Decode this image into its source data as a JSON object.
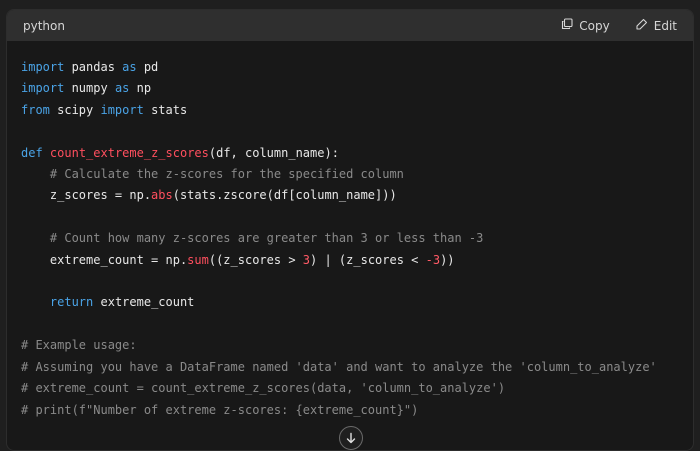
{
  "header": {
    "language": "python",
    "copy_label": "Copy",
    "edit_label": "Edit"
  },
  "code": {
    "l1_a": "import",
    "l1_b": " pandas ",
    "l1_c": "as",
    "l1_d": " pd",
    "l2_a": "import",
    "l2_b": " numpy ",
    "l2_c": "as",
    "l2_d": " np",
    "l3_a": "from",
    "l3_b": " scipy ",
    "l3_c": "import",
    "l3_d": " stats",
    "l5_a": "def",
    "l5_b": " ",
    "l5_c": "count_extreme_z_scores",
    "l5_d": "(df, column_name):",
    "l6": "    # Calculate the z-scores for the specified column",
    "l7_a": "    z_scores = np.",
    "l7_b": "abs",
    "l7_c": "(stats.zscore(df[column_name]))",
    "l9": "    # Count how many z-scores are greater than 3 or less than -3",
    "l10_a": "    extreme_count = np.",
    "l10_b": "sum",
    "l10_c": "((z_scores > ",
    "l10_d": "3",
    "l10_e": ") | (z_scores < ",
    "l10_f": "-3",
    "l10_g": "))",
    "l12_a": "    ",
    "l12_b": "return",
    "l12_c": " extreme_count",
    "l14": "# Example usage:",
    "l15": "# Assuming you have a DataFrame named 'data' and want to analyze the 'column_to_analyze'",
    "l16": "# extreme_count = count_extreme_z_scores(data, 'column_to_analyze')",
    "l17": "# print(f\"Number of extreme z-scores: {extreme_count}\")"
  },
  "icons": {
    "copy": "copy-icon",
    "edit": "edit-icon",
    "scroll": "arrow-down-icon"
  }
}
